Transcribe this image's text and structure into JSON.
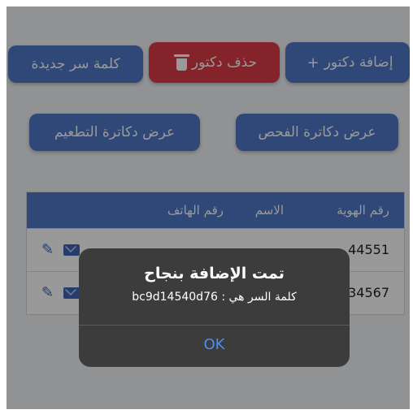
{
  "toolbar": {
    "add_doctor_label": "إضافة دكتور",
    "add_icon": "plus-icon",
    "delete_doctor_label": "حذف دكتور",
    "delete_icon": "trash-icon",
    "new_password_label": "كلمة سر جديدة"
  },
  "filters": {
    "exam_doctors_label": "عرض دكاترة الفحص",
    "vaccine_doctors_label": "عرض دكاترة التطعيم"
  },
  "table": {
    "headers": {
      "id": "رقم الهوية",
      "name": "الاسم",
      "phone": "رقم الهاتف"
    },
    "rows": [
      {
        "id_visible": "44551",
        "actions": [
          "pencil-icon",
          "mail-icon"
        ]
      },
      {
        "id_visible": "34567",
        "actions": [
          "pencil-icon",
          "mail-icon"
        ]
      }
    ]
  },
  "alert": {
    "title": "تمت الإضافة بنجاح",
    "message": "كلمة السر هي : bc9d14540d76",
    "ok_label": "OK"
  },
  "colors": {
    "primary_blue": "#4f78c8",
    "danger_red": "#dc3b47",
    "alert_bg": "#3c3c3c",
    "ok_blue": "#4a90f2"
  }
}
